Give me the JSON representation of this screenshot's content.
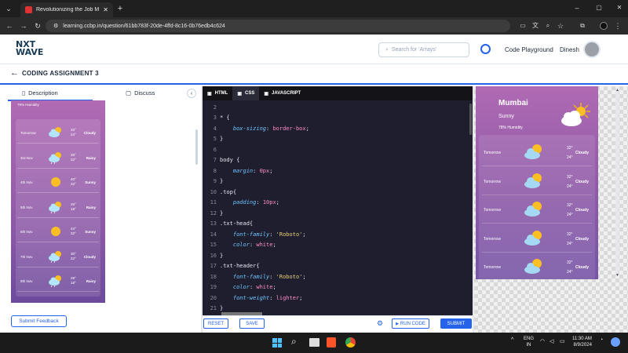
{
  "browser": {
    "tab_title": "Revolutionizing the Job Market",
    "url": "learning.ccbp.in/question/61bb783f-20de-4ffd-8c16-0b76edb4c624"
  },
  "site": {
    "logo_line1": "NXT",
    "logo_line2": "WAVE",
    "search_placeholder": "Search for 'Arrays'",
    "playground": "Code Playground",
    "user_name": "Dinesh"
  },
  "page": {
    "title": "CODING ASSIGNMENT 3"
  },
  "left_tabs": {
    "description": "Description",
    "discuss": "Discuss"
  },
  "left_preview": {
    "humidity": "78% Humidity",
    "rows": [
      {
        "day": "Tomorrow",
        "hi": "32°",
        "lo": "24°",
        "status": "Cloudy",
        "icon": "partly-cloudy-icon"
      },
      {
        "day": "3rd Nov",
        "hi": "26°",
        "lo": "22°",
        "status": "Rainy",
        "icon": "rain-cloud-icon"
      },
      {
        "day": "4th Nov",
        "hi": "40°",
        "lo": "32°",
        "status": "Sunny",
        "icon": "sun-icon"
      },
      {
        "day": "5th Nov",
        "hi": "26°",
        "lo": "18°",
        "status": "Rainy",
        "icon": "rain-sun-icon"
      },
      {
        "day": "6th Nov",
        "hi": "44°",
        "lo": "32°",
        "status": "Sunny",
        "icon": "sun-icon"
      },
      {
        "day": "7th Nov",
        "hi": "30°",
        "lo": "22°",
        "status": "Cloudy",
        "icon": "rain-cloud-icon"
      },
      {
        "day": "8th Nov",
        "hi": "29°",
        "lo": "18°",
        "status": "Rainy",
        "icon": "rain-cloud-icon"
      }
    ]
  },
  "feedback": "Submit Feedback",
  "editor": {
    "tabs": [
      "HTML",
      "CSS",
      "JAVASCRIPT"
    ],
    "active_tab": "CSS",
    "lines": [
      {
        "n": "2",
        "code": ""
      },
      {
        "n": "3",
        "code": "* {"
      },
      {
        "n": "4",
        "code": "    box-sizing: border-box;"
      },
      {
        "n": "5",
        "code": "}"
      },
      {
        "n": "6",
        "code": ""
      },
      {
        "n": "7",
        "code": "body {"
      },
      {
        "n": "8",
        "code": "    margin: 0px;"
      },
      {
        "n": "9",
        "code": "}"
      },
      {
        "n": "10",
        "code": ".top{"
      },
      {
        "n": "11",
        "code": "    padding: 10px;"
      },
      {
        "n": "12",
        "code": "}"
      },
      {
        "n": "13",
        "code": ".txt-head{"
      },
      {
        "n": "14",
        "code": "    font-family: 'Roboto';"
      },
      {
        "n": "15",
        "code": "    color: white;"
      },
      {
        "n": "16",
        "code": "}"
      },
      {
        "n": "17",
        "code": ".txt-header{"
      },
      {
        "n": "18",
        "code": "    font-family: 'Roboto';"
      },
      {
        "n": "19",
        "code": "    color: white;"
      },
      {
        "n": "20",
        "code": "    font-weight: lighter;"
      },
      {
        "n": "21",
        "code": "}"
      }
    ],
    "reset": "RESET",
    "save": "SAVE",
    "run": "RUN CODE",
    "submit": "SUBMIT"
  },
  "right_preview": {
    "city": "Mumbai",
    "condition": "Sunny",
    "humidity": "78% Humidity",
    "rows": [
      {
        "day": "Tomorrow",
        "hi": "32°",
        "lo": "24°",
        "status": "Cloudy"
      },
      {
        "day": "Tomorrow",
        "hi": "32°",
        "lo": "24°",
        "status": "Cloudy"
      },
      {
        "day": "Tomorrow",
        "hi": "32°",
        "lo": "24°",
        "status": "Cloudy"
      },
      {
        "day": "Tomorrow",
        "hi": "32°",
        "lo": "24°",
        "status": "Cloudy"
      },
      {
        "day": "Tomorrow",
        "hi": "32°",
        "lo": "24°",
        "status": "Cloudy"
      }
    ]
  },
  "taskbar": {
    "lang1": "ENG",
    "lang2": "IN",
    "time": "11:30 AM",
    "date": "8/9/2024"
  },
  "colors": {
    "accent": "#2563eb",
    "editor_bg": "#1e1e2e",
    "preview_purple": "#9b5fae"
  }
}
